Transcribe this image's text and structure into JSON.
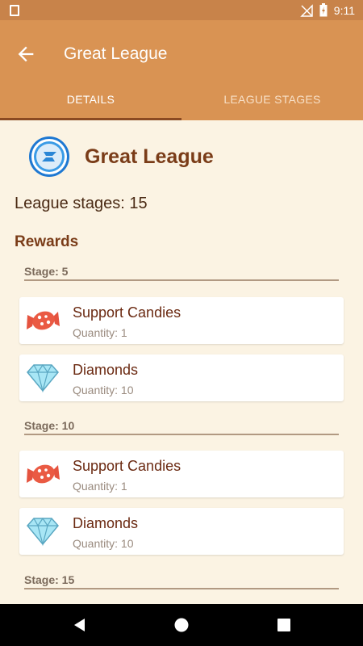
{
  "status": {
    "time": "9:11",
    "battery_label": "⚡"
  },
  "app_bar": {
    "title": "Great League"
  },
  "tabs": [
    {
      "label": "DETAILS"
    },
    {
      "label": "LEAGUE STAGES"
    }
  ],
  "league": {
    "name": "Great League",
    "stages_text": "League stages: 15"
  },
  "rewards": {
    "title": "Rewards",
    "stages": [
      {
        "label": "Stage: 5",
        "items": [
          {
            "name": "Support Candies",
            "quantity": "Quantity: 1",
            "icon": "candy-icon"
          },
          {
            "name": "Diamonds",
            "quantity": "Quantity: 10",
            "icon": "diamond-icon"
          }
        ]
      },
      {
        "label": "Stage: 10",
        "items": [
          {
            "name": "Support Candies",
            "quantity": "Quantity: 1",
            "icon": "candy-icon"
          },
          {
            "name": "Diamonds",
            "quantity": "Quantity: 10",
            "icon": "diamond-icon"
          }
        ]
      },
      {
        "label": "Stage: 15",
        "items": []
      }
    ]
  },
  "colors": {
    "status_bar": "#c8834a",
    "app_bar": "#d99353",
    "background": "#fbf3e3",
    "accent_text": "#7a3c18"
  }
}
